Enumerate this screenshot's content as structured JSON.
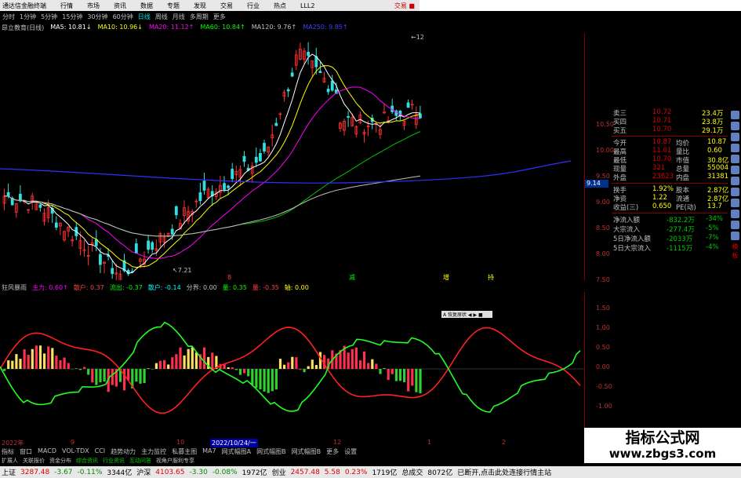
{
  "menu": {
    "app": "通达信金融终端",
    "items": [
      "行情",
      "市场",
      "资讯",
      "数据",
      "专题",
      "发现",
      "交易",
      "行业",
      "热点",
      "LLL2"
    ],
    "login": "交易 ■"
  },
  "periods": {
    "items": [
      "分时",
      "1分钟",
      "5分钟",
      "15分钟",
      "30分钟",
      "60分钟",
      "日线",
      "周线",
      "月线",
      "多周期",
      "更多"
    ],
    "selected": "日线"
  },
  "stock": {
    "name": "昂立教育(日线)"
  },
  "ma": [
    {
      "label": "MA5: 10.81↓",
      "color": "#ffffff"
    },
    {
      "label": "MA10: 10.96↓",
      "color": "#ffff00"
    },
    {
      "label": "MA20: 11.12↑",
      "color": "#ff00ff"
    },
    {
      "label": "MA60: 10.84↑",
      "color": "#00ff00"
    },
    {
      "label": "MA120: 9.76↑",
      "color": "#c0c0c0"
    },
    {
      "label": "MA250: 9.85↑",
      "color": "#4040ff"
    }
  ],
  "price_axis": [
    "10.50",
    "10.00",
    "9.50",
    "9.00",
    "8.50",
    "8.00",
    "7.50"
  ],
  "price_tag": "9.14",
  "annotations": {
    "high": "12",
    "low": "7.21"
  },
  "markers": [
    {
      "text": "8",
      "color": "#ff4040"
    },
    {
      "text": "减",
      "color": "#00ff00"
    },
    {
      "text": "增",
      "color": "#ffff00"
    },
    {
      "text": "持",
      "color": "#ffff00"
    }
  ],
  "indicator": {
    "name": "狂风暴雨",
    "items": [
      {
        "label": "主力: 0.60↑",
        "color": "#ff00ff"
      },
      {
        "label": "散户: 0.37",
        "color": "#ff4040"
      },
      {
        "label": "流出: -0.37",
        "color": "#00ff00"
      },
      {
        "label": "散户: -0.14",
        "color": "#00ffff"
      },
      {
        "label": "分界: 0.00",
        "color": "#c0c0c0"
      },
      {
        "label": "量: 0.35",
        "color": "#00ff00"
      },
      {
        "label": "量: -0.35",
        "color": "#ff4040"
      },
      {
        "label": "轴: 0.00",
        "color": "#ffff00"
      }
    ]
  },
  "ind_axis": [
    "1.50",
    "1.00",
    "0.50",
    "0.00",
    "-0.50",
    "-1.00"
  ],
  "popup": "A 恢复原状 ◀ ▶ ■",
  "dates": [
    "2022年",
    "9",
    "10",
    "2022/10/24/一",
    "12",
    "1",
    "2"
  ],
  "tabs": [
    "指标",
    "窗口",
    "MACD",
    "VOL-TDX",
    "CCI",
    "趋势动力",
    "主力监控",
    "私募主图",
    "MA7",
    "网式幅图A",
    "网式幅图B",
    "网式幅图B",
    "更多",
    "设置"
  ],
  "tabs2": [
    "扩展人",
    "关联报价",
    "资金分布",
    "综合资讯",
    "行业资讯",
    "互动问答",
    "视角户服利专享"
  ],
  "tabs2_hot": [
    "综合资讯",
    "行业资讯",
    "互动问答"
  ],
  "quote": {
    "book": [
      [
        "卖三",
        "10.72",
        "23.4万"
      ],
      [
        "买四",
        "10.71",
        "23.8万"
      ],
      [
        "买五",
        "10.70",
        "29.1万"
      ]
    ],
    "stats": [
      [
        "今开",
        "10.87",
        "均价",
        "10.87"
      ],
      [
        "最高",
        "11.01",
        "量比",
        "0.60"
      ],
      [
        "最低",
        "10.70",
        "市值",
        "30.8亿"
      ],
      [
        "现量",
        "321",
        "总量",
        "55004"
      ],
      [
        "外盘",
        "23623",
        "内盘",
        "31381"
      ]
    ],
    "stats2": [
      [
        "换手",
        "1.92%",
        "股本",
        "2.87亿"
      ],
      [
        "净资",
        "1.22",
        "流通",
        "2.87亿"
      ],
      [
        "收益(三)",
        "0.650",
        "PE(动)",
        "13.7"
      ]
    ],
    "flows": [
      [
        "净流入额",
        "-832.2万",
        "-34%"
      ],
      [
        "大宗流入",
        "-277.4万",
        "-5%"
      ],
      [
        "5日净流入额",
        "-2033万",
        "-7%"
      ],
      [
        "5日大宗流入",
        "-1115万",
        "-4%"
      ]
    ]
  },
  "status": {
    "items": [
      {
        "t": "上证",
        "c": "#000"
      },
      {
        "t": "3287.48",
        "c": "#d00"
      },
      {
        "t": "-3.67",
        "c": "#080"
      },
      {
        "t": "-0.11%",
        "c": "#080"
      },
      {
        "t": "3344亿",
        "c": "#000"
      },
      {
        "t": "沪深",
        "c": "#000"
      },
      {
        "t": "4103.65",
        "c": "#d00"
      },
      {
        "t": "-3.30",
        "c": "#080"
      },
      {
        "t": "-0.08%",
        "c": "#080"
      },
      {
        "t": "1972亿",
        "c": "#000"
      },
      {
        "t": "创业",
        "c": "#000"
      },
      {
        "t": "2457.48",
        "c": "#d00"
      },
      {
        "t": "5.58",
        "c": "#d00"
      },
      {
        "t": "0.23%",
        "c": "#d00"
      },
      {
        "t": "1719亿",
        "c": "#000"
      },
      {
        "t": "总成交",
        "c": "#000"
      },
      {
        "t": "8072亿",
        "c": "#000"
      },
      {
        "t": "已断开,点击此处连接行情主站",
        "c": "#000"
      }
    ]
  },
  "watermark": {
    "line1": "指标公式网",
    "line2": "www.zbgs3.com"
  },
  "right_label": "模板"
}
